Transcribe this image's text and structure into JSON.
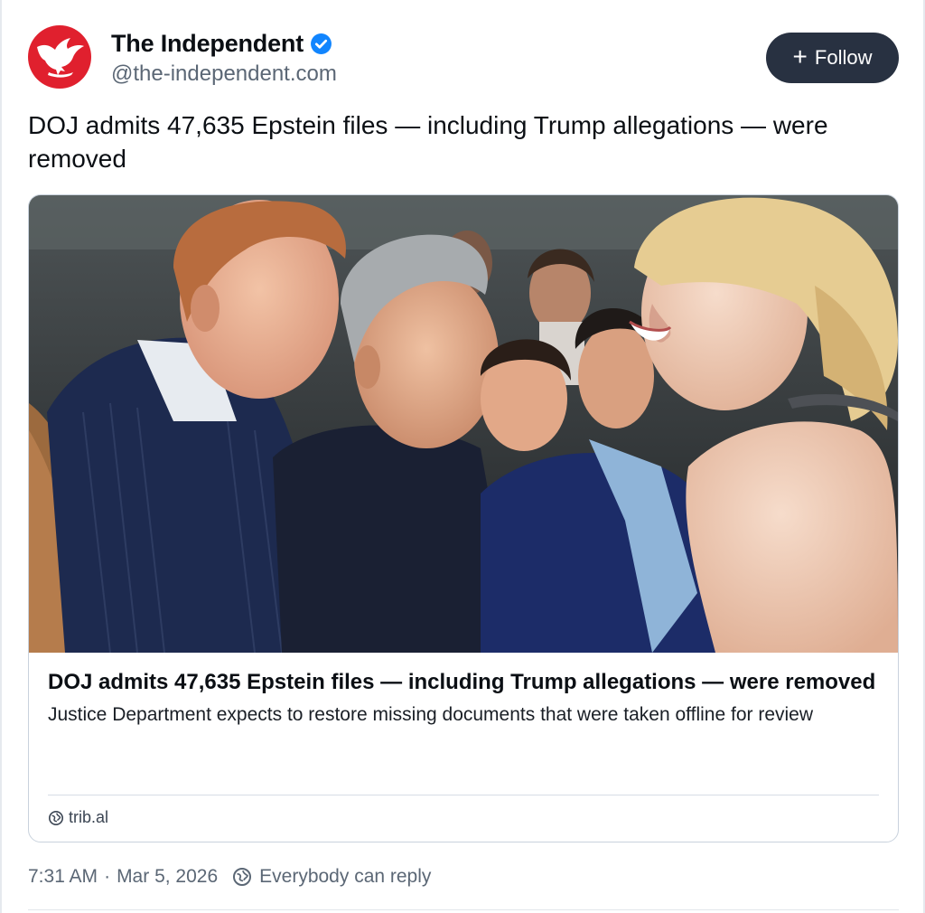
{
  "author": {
    "display_name": "The Independent",
    "handle": "@the-independent.com",
    "verified": true,
    "avatar_icon": "eagle-logo-icon",
    "brand_color": "#e0202e"
  },
  "follow_button": {
    "icon": "plus-icon",
    "label": "Follow"
  },
  "post": {
    "text": "DOJ admits 47,635 Epstein files — including Trump allegations — were removed"
  },
  "link_card": {
    "image_icon": "news-photo",
    "title": "DOJ admits 47,635 Epstein files — including Trump allegations — were removed",
    "description": "Justice Department expects to restore missing documents that were taken offline for review",
    "source_icon": "globe-icon",
    "source": "trib.al"
  },
  "meta": {
    "time": "7:31 AM",
    "separator": "·",
    "date": "Mar 5, 2026",
    "reply_icon": "globe-icon",
    "reply_setting": "Everybody can reply"
  }
}
